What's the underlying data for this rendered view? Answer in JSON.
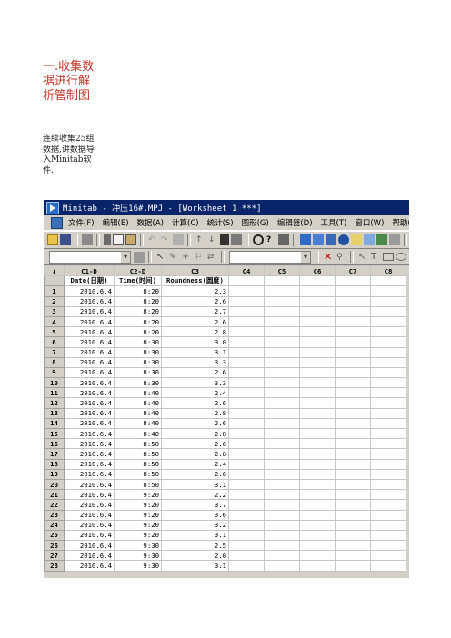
{
  "heading": "一.收集数据进行解析管制图",
  "paragraph": "连续收集25组数据,讲数据导入Minitab软件.",
  "window": {
    "title": "Minitab - 冲压16#.MPJ - [Worksheet 1 ***]"
  },
  "menu": [
    "文件(F)",
    "编辑(E)",
    "数据(A)",
    "计算(C)",
    "统计(S)",
    "图形(G)",
    "编辑器(D)",
    "工具(T)",
    "窗口(W)",
    "帮助(H)"
  ],
  "worksheet": {
    "corner": "↓",
    "columns": [
      "C1-D",
      "C2-D",
      "C3",
      "C4",
      "C5",
      "C6",
      "C7",
      "C8"
    ],
    "names": [
      "Date(日期)",
      "Time(时间)",
      "Roundness(圆度)",
      "",
      "",
      "",
      "",
      ""
    ],
    "rows": [
      {
        "n": "1",
        "date": "2010.6.4",
        "time": "8:20",
        "round": "2.3"
      },
      {
        "n": "2",
        "date": "2010.6.4",
        "time": "8:20",
        "round": "2.6"
      },
      {
        "n": "3",
        "date": "2010.6.4",
        "time": "8:20",
        "round": "2.7"
      },
      {
        "n": "4",
        "date": "2010.6.4",
        "time": "8:20",
        "round": "2.6"
      },
      {
        "n": "5",
        "date": "2010.6.4",
        "time": "8:20",
        "round": "2.8"
      },
      {
        "n": "6",
        "date": "2010.6.4",
        "time": "8:30",
        "round": "3.0"
      },
      {
        "n": "7",
        "date": "2010.6.4",
        "time": "8:30",
        "round": "3.1"
      },
      {
        "n": "8",
        "date": "2010.6.4",
        "time": "8:30",
        "round": "3.3"
      },
      {
        "n": "9",
        "date": "2010.6.4",
        "time": "8:30",
        "round": "2.6"
      },
      {
        "n": "10",
        "date": "2010.6.4",
        "time": "8:30",
        "round": "3.3"
      },
      {
        "n": "11",
        "date": "2010.6.4",
        "time": "8:40",
        "round": "2.4"
      },
      {
        "n": "12",
        "date": "2010.6.4",
        "time": "8:40",
        "round": "2.6"
      },
      {
        "n": "13",
        "date": "2010.6.4",
        "time": "8:40",
        "round": "2.8"
      },
      {
        "n": "14",
        "date": "2010.6.4",
        "time": "8:40",
        "round": "2.6"
      },
      {
        "n": "15",
        "date": "2010.6.4",
        "time": "8:40",
        "round": "2.8"
      },
      {
        "n": "16",
        "date": "2010.6.4",
        "time": "8:50",
        "round": "2.6"
      },
      {
        "n": "17",
        "date": "2010.6.4",
        "time": "8:50",
        "round": "2.8"
      },
      {
        "n": "18",
        "date": "2010.6.4",
        "time": "8:50",
        "round": "2.4"
      },
      {
        "n": "19",
        "date": "2010.6.4",
        "time": "8:50",
        "round": "2.6"
      },
      {
        "n": "20",
        "date": "2010.6.4",
        "time": "8:50",
        "round": "3.1"
      },
      {
        "n": "21",
        "date": "2010.6.4",
        "time": "9:20",
        "round": "2.2"
      },
      {
        "n": "22",
        "date": "2010.6.4",
        "time": "9:20",
        "round": "3.7"
      },
      {
        "n": "23",
        "date": "2010.6.4",
        "time": "9:20",
        "round": "3.6"
      },
      {
        "n": "24",
        "date": "2010.6.4",
        "time": "9:20",
        "round": "3.2"
      },
      {
        "n": "25",
        "date": "2010.6.4",
        "time": "9:20",
        "round": "3.1"
      },
      {
        "n": "26",
        "date": "2010.6.4",
        "time": "9:30",
        "round": "2.5"
      },
      {
        "n": "27",
        "date": "2010.6.4",
        "time": "9:30",
        "round": "2.0"
      },
      {
        "n": "28",
        "date": "2010.6.4",
        "time": "9:30",
        "round": "3.1"
      }
    ]
  },
  "colors": {
    "title_bg": "#0a246a",
    "heading": "#c0392b",
    "chrome": "#d4d0c8"
  }
}
